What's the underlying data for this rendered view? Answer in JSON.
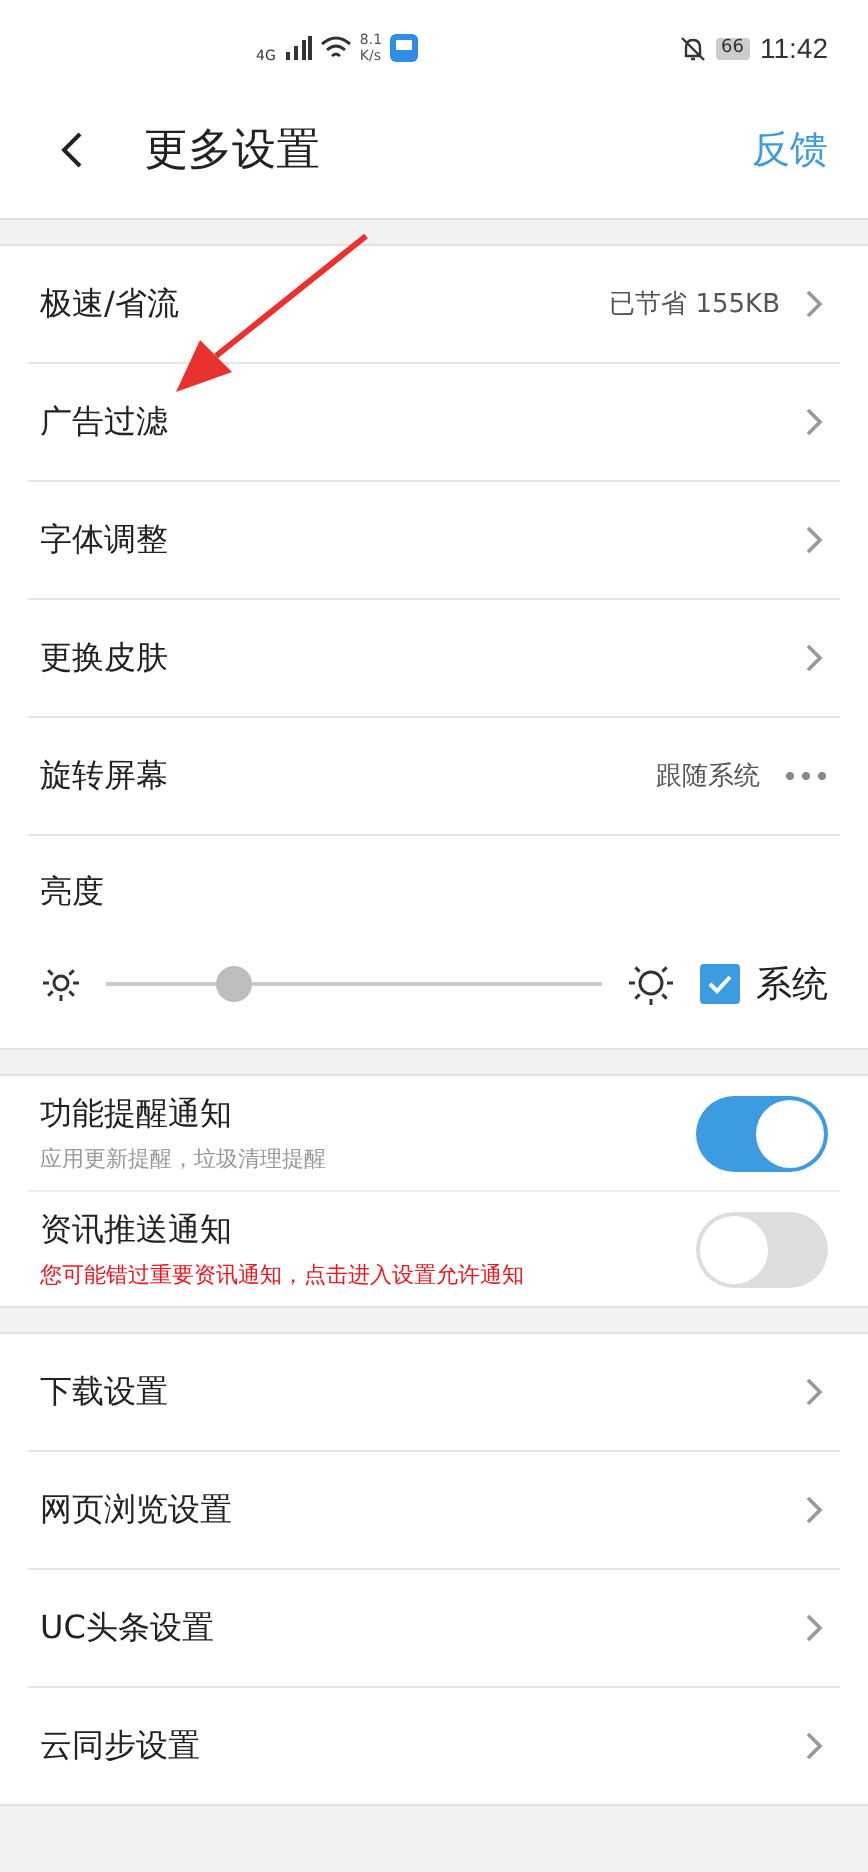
{
  "status_bar": {
    "network": "4G",
    "speed_value": "8.1",
    "speed_unit": "K/s",
    "battery": "66",
    "time": "11:42"
  },
  "header": {
    "title": "更多设置",
    "action": "反馈"
  },
  "general": [
    {
      "kind": "link",
      "label": "极速/省流",
      "value": "已节省 155KB"
    },
    {
      "kind": "link",
      "label": "广告过滤"
    },
    {
      "kind": "link",
      "label": "字体调整"
    },
    {
      "kind": "link",
      "label": "更换皮肤"
    },
    {
      "kind": "menu",
      "label": "旋转屏幕",
      "value": "跟随系统"
    }
  ],
  "brightness": {
    "label": "亮度",
    "level": 0.22,
    "system_label": "系统",
    "system_checked": true
  },
  "notifications": [
    {
      "title": "功能提醒通知",
      "subtitle": "应用更新提醒，垃圾清理提醒",
      "warning": false,
      "on": true
    },
    {
      "title": "资讯推送通知",
      "subtitle": "您可能错过重要资讯通知，点击进入设置允许通知",
      "warning": true,
      "on": false
    }
  ],
  "more": [
    {
      "kind": "link",
      "label": "下载设置"
    },
    {
      "kind": "link",
      "label": "网页浏览设置"
    },
    {
      "kind": "link",
      "label": "UC头条设置"
    },
    {
      "kind": "link",
      "label": "云同步设置"
    }
  ],
  "annotation": {
    "kind": "arrow"
  }
}
